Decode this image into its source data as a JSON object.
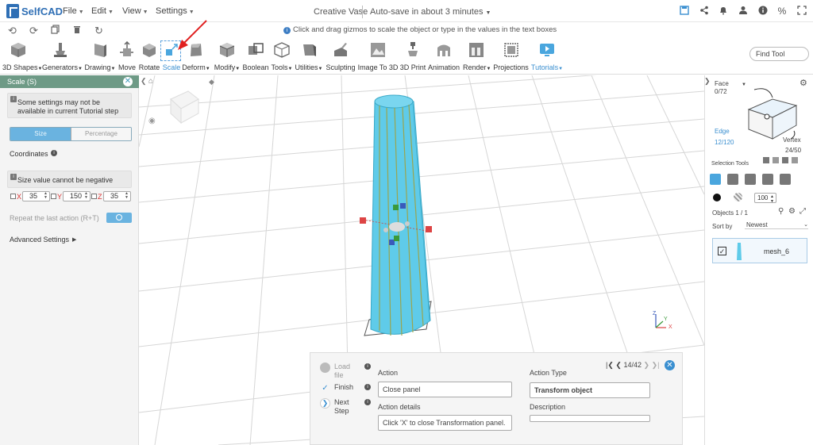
{
  "app": {
    "name": "SelfCAD",
    "document_title": "Creative Vase",
    "autosave": "Auto-save in about 3 minutes"
  },
  "menus": [
    {
      "label": "File"
    },
    {
      "label": "Edit"
    },
    {
      "label": "View"
    },
    {
      "label": "Settings"
    }
  ],
  "top_icons": [
    "save-icon",
    "share-icon",
    "bell-icon",
    "user-icon",
    "info-icon",
    "percent-icon",
    "fullscreen-icon"
  ],
  "quick_icons": [
    "undo-icon",
    "redo-icon",
    "copy-icon",
    "trash-icon",
    "reset-icon"
  ],
  "hint": "Click and drag gizmos to scale the object or type in the values in the text boxes",
  "toolbar": {
    "tools": [
      {
        "label": "3D Shapes"
      },
      {
        "label": "Generators"
      },
      {
        "label": "Drawing"
      },
      {
        "label": "Move"
      },
      {
        "label": "Rotate"
      },
      {
        "label": "Scale"
      },
      {
        "label": "Deform"
      },
      {
        "label": "Modify"
      },
      {
        "label": "Boolean"
      },
      {
        "label": "Tools"
      },
      {
        "label": "Utilities"
      },
      {
        "label": "Sculpting"
      },
      {
        "label": "Image To 3D"
      },
      {
        "label": "3D Print"
      },
      {
        "label": "Animation"
      },
      {
        "label": "Render"
      },
      {
        "label": "Projections"
      },
      {
        "label": "Tutorials"
      }
    ],
    "find_tool": "Find Tool",
    "accent": "#3a8fd0"
  },
  "scale_panel": {
    "title": "Scale (S)",
    "note1": "Some settings may not be available in current Tutorial step",
    "modes": [
      "Size",
      "Percentage"
    ],
    "coordinates_label": "Coordinates",
    "note2": "Size value cannot be negative",
    "x": {
      "label": "X",
      "value": "35"
    },
    "y": {
      "label": "Y",
      "value": "150"
    },
    "z": {
      "label": "Z",
      "value": "35"
    },
    "repeat_label": "Repeat the last action (R+T)",
    "advanced_label": "Advanced Settings",
    "header_color": "#6e9a86"
  },
  "tutorial": {
    "steps": [
      {
        "label": "Load file"
      },
      {
        "label": "Finish"
      },
      {
        "label": "Next Step"
      }
    ],
    "pager": "14/42",
    "action_label": "Action",
    "action_value": "Close panel",
    "details_label": "Action details",
    "details_value": "Click 'X' to close Transformation panel.",
    "action_type_label": "Action Type",
    "action_type_value": "Transform object",
    "description_label": "Description",
    "description_value": ""
  },
  "right_panel": {
    "face_label": "Face",
    "face_count": "0/72",
    "edge_label": "Edge",
    "edge_count": "12/120",
    "vertex_label": "Vertex",
    "vertex_count": "24/50",
    "selection_tools_label": "Selection Tools",
    "opacity_value": "100",
    "objects_label": "Objects 1 / 1",
    "sort_label": "Sort by",
    "sort_value": "Newest",
    "object_name": "mesh_6"
  },
  "viewport": {
    "object_color": "#5fcbe9",
    "axis_labels": [
      "Z",
      "Y",
      "X"
    ]
  }
}
